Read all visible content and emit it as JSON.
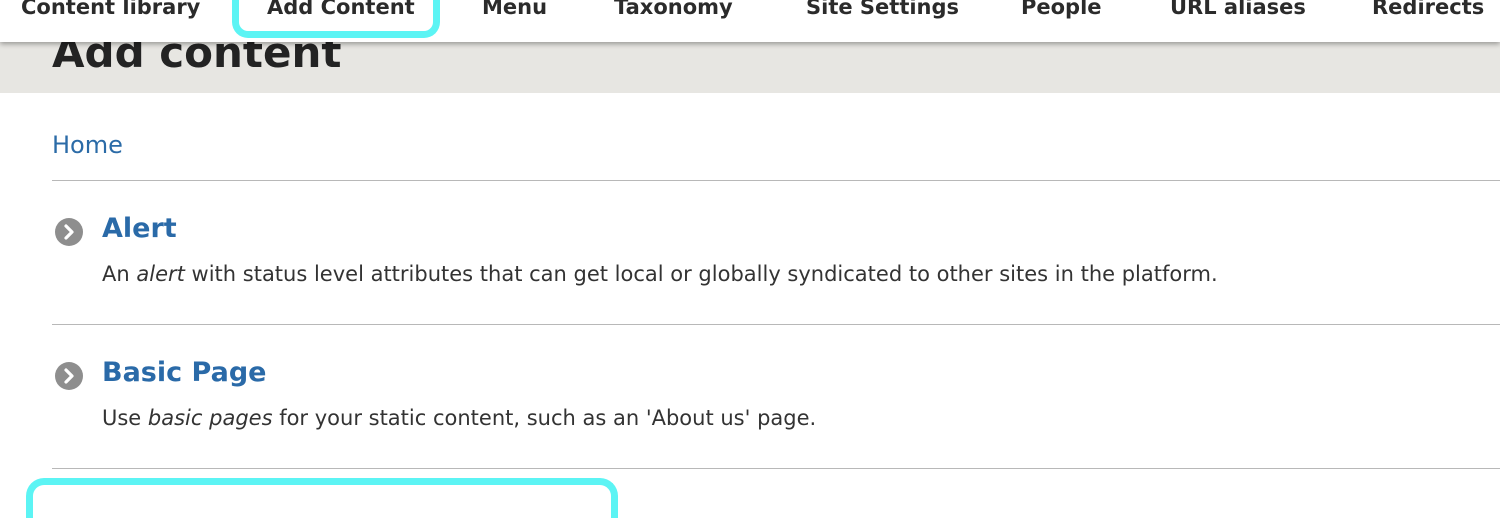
{
  "toolbar": {
    "items": [
      {
        "label": "Content library"
      },
      {
        "label": "Add Content"
      },
      {
        "label": "Menu"
      },
      {
        "label": "Taxonomy"
      },
      {
        "label": "Site Settings"
      },
      {
        "label": "People"
      },
      {
        "label": "URL aliases"
      },
      {
        "label": "Redirects"
      }
    ]
  },
  "page": {
    "title": "Add content"
  },
  "breadcrumb": {
    "home": "Home"
  },
  "content_types": [
    {
      "title": "Alert",
      "desc_prefix": "An ",
      "desc_emphasis": "alert",
      "desc_suffix": " with status level attributes that can get local or globally syndicated to other sites in the platform."
    },
    {
      "title": "Basic Page",
      "desc_prefix": "Use ",
      "desc_emphasis": "basic pages",
      "desc_suffix": " for your static content, such as an 'About us' page."
    }
  ],
  "colors": {
    "highlight": "#5cf4f4",
    "link": "#2a6aa8",
    "title_band": "#e7e6e2"
  },
  "icons": {
    "content_type_bullet": "chevron-circle-right-icon"
  }
}
